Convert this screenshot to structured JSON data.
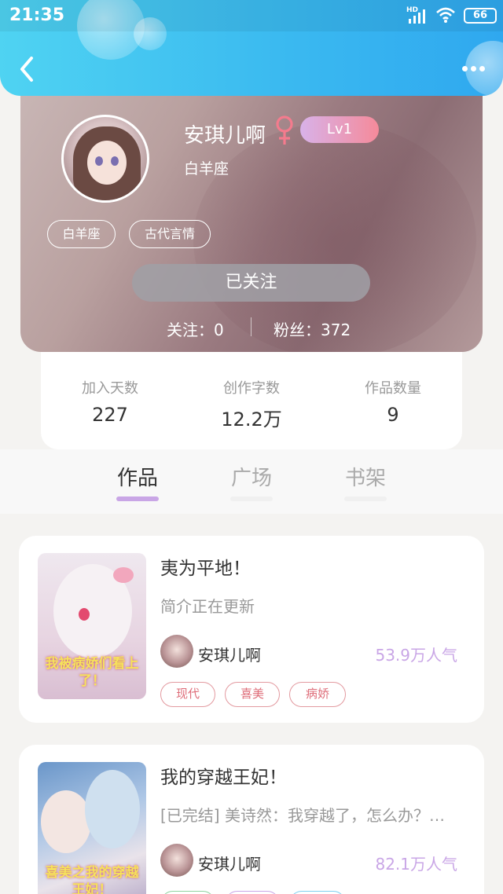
{
  "status_bar": {
    "time": "21:35",
    "network": "HD",
    "battery": "66"
  },
  "header": {
    "back_icon": "chevron-left-icon",
    "more_icon": "more-dots-icon"
  },
  "profile": {
    "name": "安琪儿啊",
    "gender_icon": "female-icon",
    "level": "Lv1",
    "signature": "白羊座",
    "tags": [
      "白羊座",
      "古代言情"
    ],
    "follow_button": "已关注",
    "following": "关注：0",
    "fans": "粉丝：372"
  },
  "stats": [
    {
      "label": "加入天数",
      "value": "227"
    },
    {
      "label": "创作字数",
      "value": "12.2万"
    },
    {
      "label": "作品数量",
      "value": "9"
    }
  ],
  "tabs": [
    {
      "label": "作品",
      "active": true
    },
    {
      "label": "广场",
      "active": false
    },
    {
      "label": "书架",
      "active": false
    }
  ],
  "works": [
    {
      "title": "夷为平地！",
      "desc": "简介正在更新",
      "cover_text": "我被病娇们看上了！",
      "author": "安琪儿啊",
      "popularity": "53.9万人气",
      "tags": [
        "现代",
        "喜美",
        "病娇"
      ]
    },
    {
      "title": "我的穿越王妃！",
      "desc": "[已完结] 美诗然：我穿越了，怎么办？…",
      "cover_text": "喜美之我的穿越王妃！",
      "author": "安琪儿啊",
      "popularity": "82.1万人气"
    }
  ],
  "colors": {
    "accent": "#c9a6e6",
    "header": "#3bbaf0",
    "tag_red": "#de6c78"
  }
}
